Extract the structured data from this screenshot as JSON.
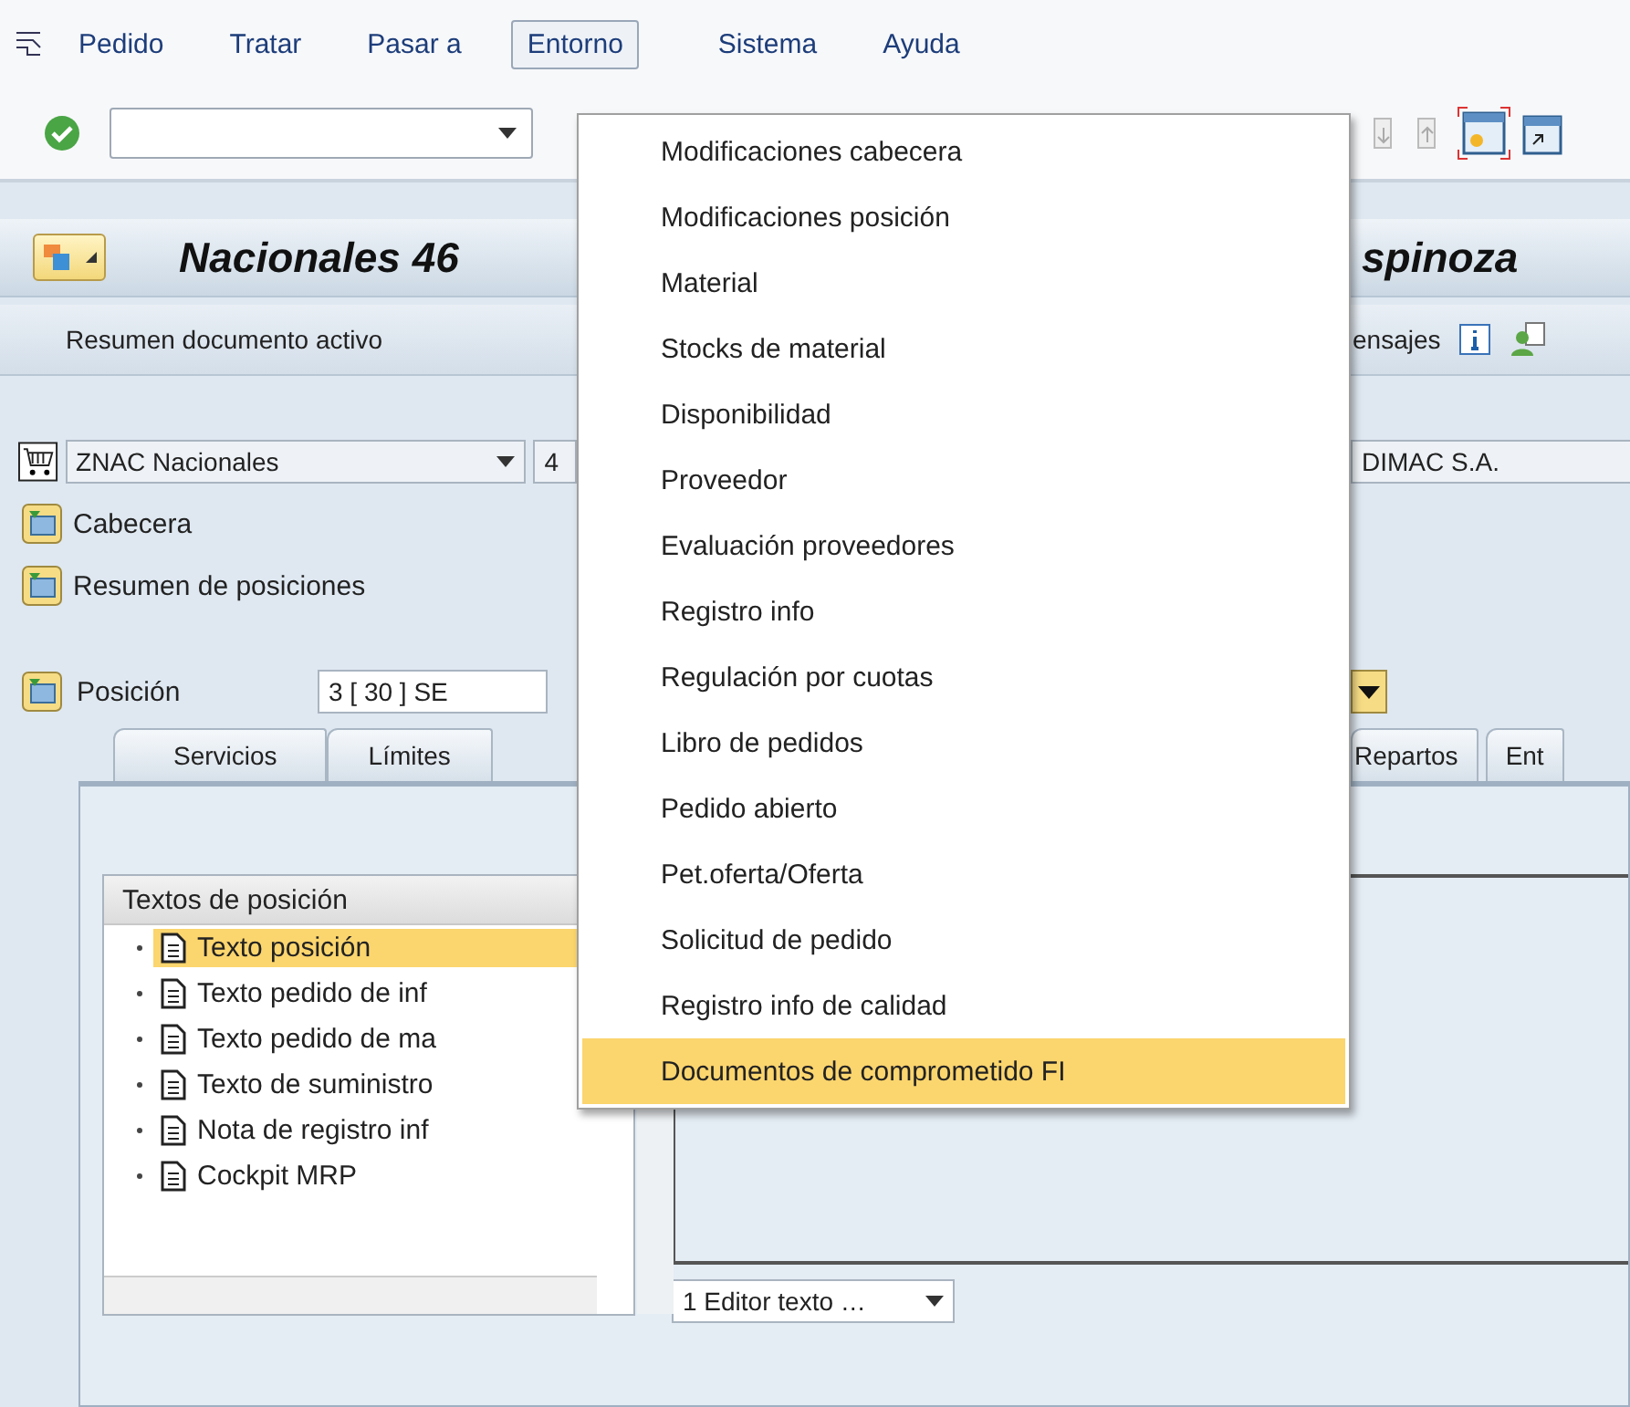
{
  "menu_bar": {
    "items": [
      {
        "label": "Pedido",
        "selected": false
      },
      {
        "label": "Tratar",
        "selected": false
      },
      {
        "label": "Pasar a",
        "selected": false
      },
      {
        "label": "Entorno",
        "selected": true
      },
      {
        "label": "Sistema",
        "selected": false
      },
      {
        "label": "Ayuda",
        "selected": false
      }
    ]
  },
  "title": {
    "left": "Nacionales 46",
    "right": "spinoza"
  },
  "app_toolbar": {
    "left": "Resumen documento activo",
    "right": "ensajes"
  },
  "header": {
    "doc_type": "ZNAC Nacionales",
    "number": "4",
    "vendor": "DIMAC S.A."
  },
  "sections": [
    {
      "label": "Cabecera"
    },
    {
      "label": "Resumen de posiciones"
    }
  ],
  "item_row": {
    "label": "Posición",
    "value": "3 [ 30 ] SE"
  },
  "tabs": [
    {
      "label": "Servicios",
      "selected": false
    },
    {
      "label": "Límites",
      "selected": false
    },
    {
      "label": "Repartos",
      "selected": false
    },
    {
      "label": "Ent",
      "selected": false
    }
  ],
  "texts_tree": {
    "header": "Textos de posición",
    "items": [
      {
        "label": "Texto posición",
        "selected": true
      },
      {
        "label": "Texto pedido de inf",
        "selected": false
      },
      {
        "label": "Texto pedido de ma",
        "selected": false
      },
      {
        "label": "Texto de suministro",
        "selected": false
      },
      {
        "label": "Nota de registro inf",
        "selected": false
      },
      {
        "label": "Cockpit MRP",
        "selected": false
      }
    ]
  },
  "editor_select": {
    "value": "1 Editor texto …"
  },
  "dropdown_menu": {
    "items": [
      {
        "label": "Modificaciones cabecera",
        "selected": false
      },
      {
        "label": "Modificaciones posición",
        "selected": false
      },
      {
        "label": "Material",
        "selected": false
      },
      {
        "label": "Stocks de material",
        "selected": false
      },
      {
        "label": "Disponibilidad",
        "selected": false
      },
      {
        "label": "Proveedor",
        "selected": false
      },
      {
        "label": "Evaluación proveedores",
        "selected": false
      },
      {
        "label": "Registro info",
        "selected": false
      },
      {
        "label": "Regulación por cuotas",
        "selected": false
      },
      {
        "label": "Libro de pedidos",
        "selected": false
      },
      {
        "label": "Pedido abierto",
        "selected": false
      },
      {
        "label": "Pet.oferta/Oferta",
        "selected": false
      },
      {
        "label": "Solicitud de pedido",
        "selected": false
      },
      {
        "label": "Registro info de calidad",
        "selected": false
      },
      {
        "label": "Documentos de comprometido FI",
        "selected": true
      }
    ]
  }
}
